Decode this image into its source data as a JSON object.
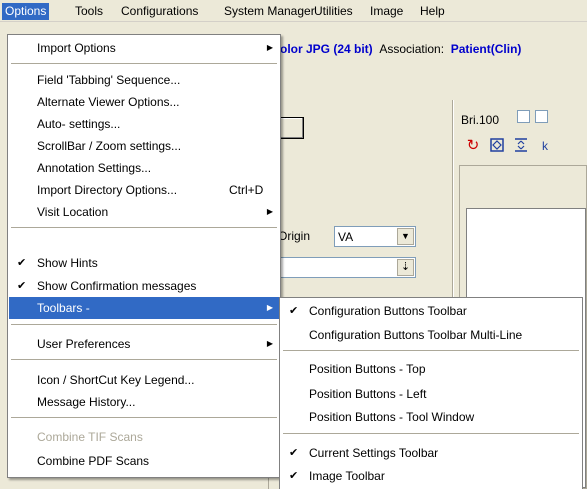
{
  "menubar": {
    "items": [
      "Options",
      "Tools",
      "Configurations",
      "System Manager",
      "Utilities",
      "Image",
      "Help"
    ]
  },
  "background": {
    "file_type_partial": "olor JPG (24 bit)",
    "association_label": "Association:",
    "association_value": "Patient(Clin)",
    "origin_label": "Origin",
    "origin_value": "VA",
    "brightness_label": "Bri.100",
    "toolbar_icons": [
      "refresh-icon",
      "fit-window-icon",
      "fit-height-icon",
      "partial-icon"
    ]
  },
  "options_menu": {
    "import_options": "Import Options",
    "field_tabbing": "Field 'Tabbing' Sequence...",
    "alternate_viewer": "Alternate Viewer Options...",
    "auto_settings": "Auto- settings...",
    "scrollbar_zoom": "ScrollBar / Zoom settings...",
    "annotation_settings": "Annotation Settings...",
    "import_directory": "Import Directory Options...",
    "import_directory_shortcut": "Ctrl+D",
    "visit_location": "Visit Location",
    "show_hints": "Show Hints",
    "show_hints_checked": true,
    "show_confirmation": "Show Confirmation messages",
    "show_confirmation_checked": true,
    "toolbars": "Toolbars -",
    "user_preferences": "User Preferences",
    "icon_legend": "Icon / ShortCut Key Legend...",
    "message_history": "Message History...",
    "combine_tif": "Combine TIF Scans",
    "combine_pdf": "Combine PDF Scans"
  },
  "toolbars_submenu": {
    "config_buttons_toolbar": "Configuration Buttons Toolbar",
    "config_buttons_toolbar_checked": true,
    "config_buttons_multiline": "Configuration Buttons Toolbar Multi-Line",
    "position_top": "Position Buttons - Top",
    "position_left": "Position Buttons - Left",
    "position_tool_window": "Position Buttons - Tool Window",
    "current_settings_toolbar": "Current Settings Toolbar",
    "current_settings_toolbar_checked": true,
    "image_toolbar": "Image Toolbar",
    "image_toolbar_checked": true
  },
  "glyphs": {
    "check": "✔",
    "submenu_arrow": "▶",
    "dropdown_arrow": "▼",
    "down_arrow": "⇣"
  },
  "colors": {
    "highlight": "#316ac5",
    "menubar_bg": "#ece9d8",
    "disabled_text": "#aca899",
    "link_blue": "#0000cc",
    "refresh_red": "#cc0000"
  }
}
